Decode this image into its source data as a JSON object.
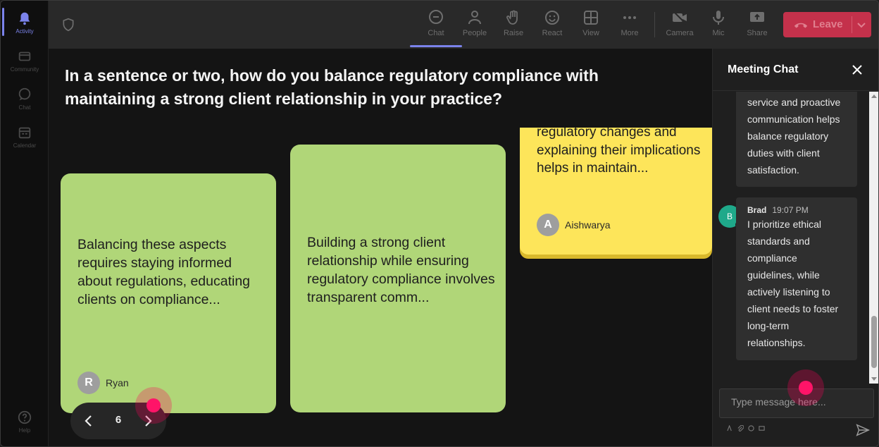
{
  "rail": {
    "items": [
      {
        "label": "Activity",
        "active": true
      },
      {
        "label": "Community"
      },
      {
        "label": "Chat"
      },
      {
        "label": "Calendar"
      },
      {
        "label": "Help"
      }
    ]
  },
  "toolbar": {
    "chat": "Chat",
    "people": "People",
    "raise": "Raise",
    "react": "React",
    "view": "View",
    "more": "More",
    "camera": "Camera",
    "mic": "Mic",
    "share": "Share",
    "leave": "Leave"
  },
  "stage": {
    "question": "In a sentence or two, how do you balance regulatory compliance with maintaining a strong client relationship in your practice?",
    "cards": [
      {
        "text": "Balancing these aspects requires staying informed about regulations, educating clients on compliance...",
        "author_initial": "R",
        "author": "Ryan",
        "color": "#b0d678"
      },
      {
        "text": "Building a strong client relationship while ensuring regulatory compliance involves transparent comm...",
        "author_initial": "",
        "author": "",
        "color": "#b0d678"
      },
      {
        "text": "regulatory changes and explaining their implications helps in maintain...",
        "author_initial": "A",
        "author": "Aishwarya",
        "color": "#fde55a"
      }
    ],
    "pager": {
      "page": "6"
    }
  },
  "chat": {
    "title": "Meeting Chat",
    "messages": [
      {
        "lines": [
          "service and proactive",
          "communication helps",
          "balance regulatory",
          "duties with client",
          "satisfaction."
        ]
      },
      {
        "avatar": "B",
        "sender": "Brad",
        "time": "19:07 PM",
        "lines": [
          "I prioritize ethical",
          "standards and",
          "compliance",
          "guidelines, while",
          "actively listening to",
          "client needs to foster",
          "long-term",
          "relationships."
        ]
      }
    ],
    "input_placeholder": "Type message here..."
  },
  "colors": {
    "accent": "#7b83eb",
    "leave": "#c4314b",
    "card_green": "#b0d678",
    "card_yellow": "#fde55a",
    "cursor": "#ff1468"
  }
}
